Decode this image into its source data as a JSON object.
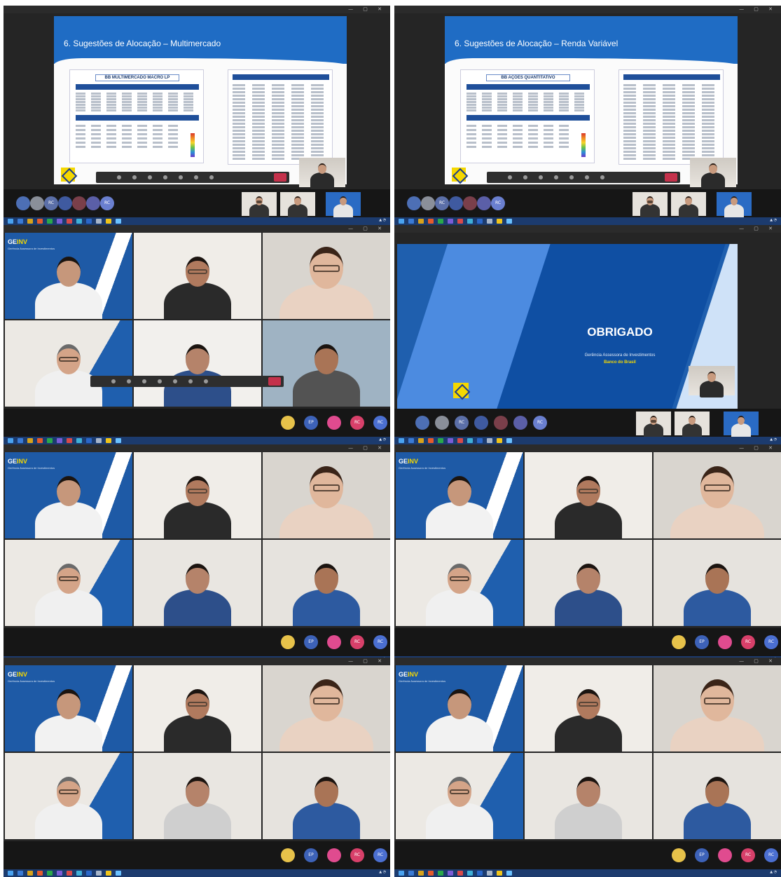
{
  "slides": {
    "multimercado": {
      "title": "6. Sugestões de Alocação – Multimercado",
      "fund_name": "BB MULTIMERCADO MACRO LP"
    },
    "renda_variavel": {
      "title": "6. Sugestões de Alocação – Renda Variável",
      "fund_name": "BB AÇÕES QUANTITATIVO"
    },
    "closing": {
      "title": "OBRIGADO",
      "subtitle": "Gerência Assessora de Investimentos",
      "bank": "Banco do Brasil"
    }
  },
  "brand": {
    "geinv_prefix": "GE",
    "geinv_suffix": "INV",
    "geinv_sub": "Gerência Assessora de Investimentos"
  },
  "avatars": [
    "",
    "",
    "RC",
    "",
    "",
    "",
    "RC"
  ],
  "bottom_avatars": [
    "",
    "EP",
    "",
    "RC",
    "RC"
  ],
  "colors": {
    "bb_blue": "#1f5fae",
    "bb_yellow": "#f5d800",
    "leave_red": "#c4314b",
    "taskbar": "#1c3b6e"
  }
}
